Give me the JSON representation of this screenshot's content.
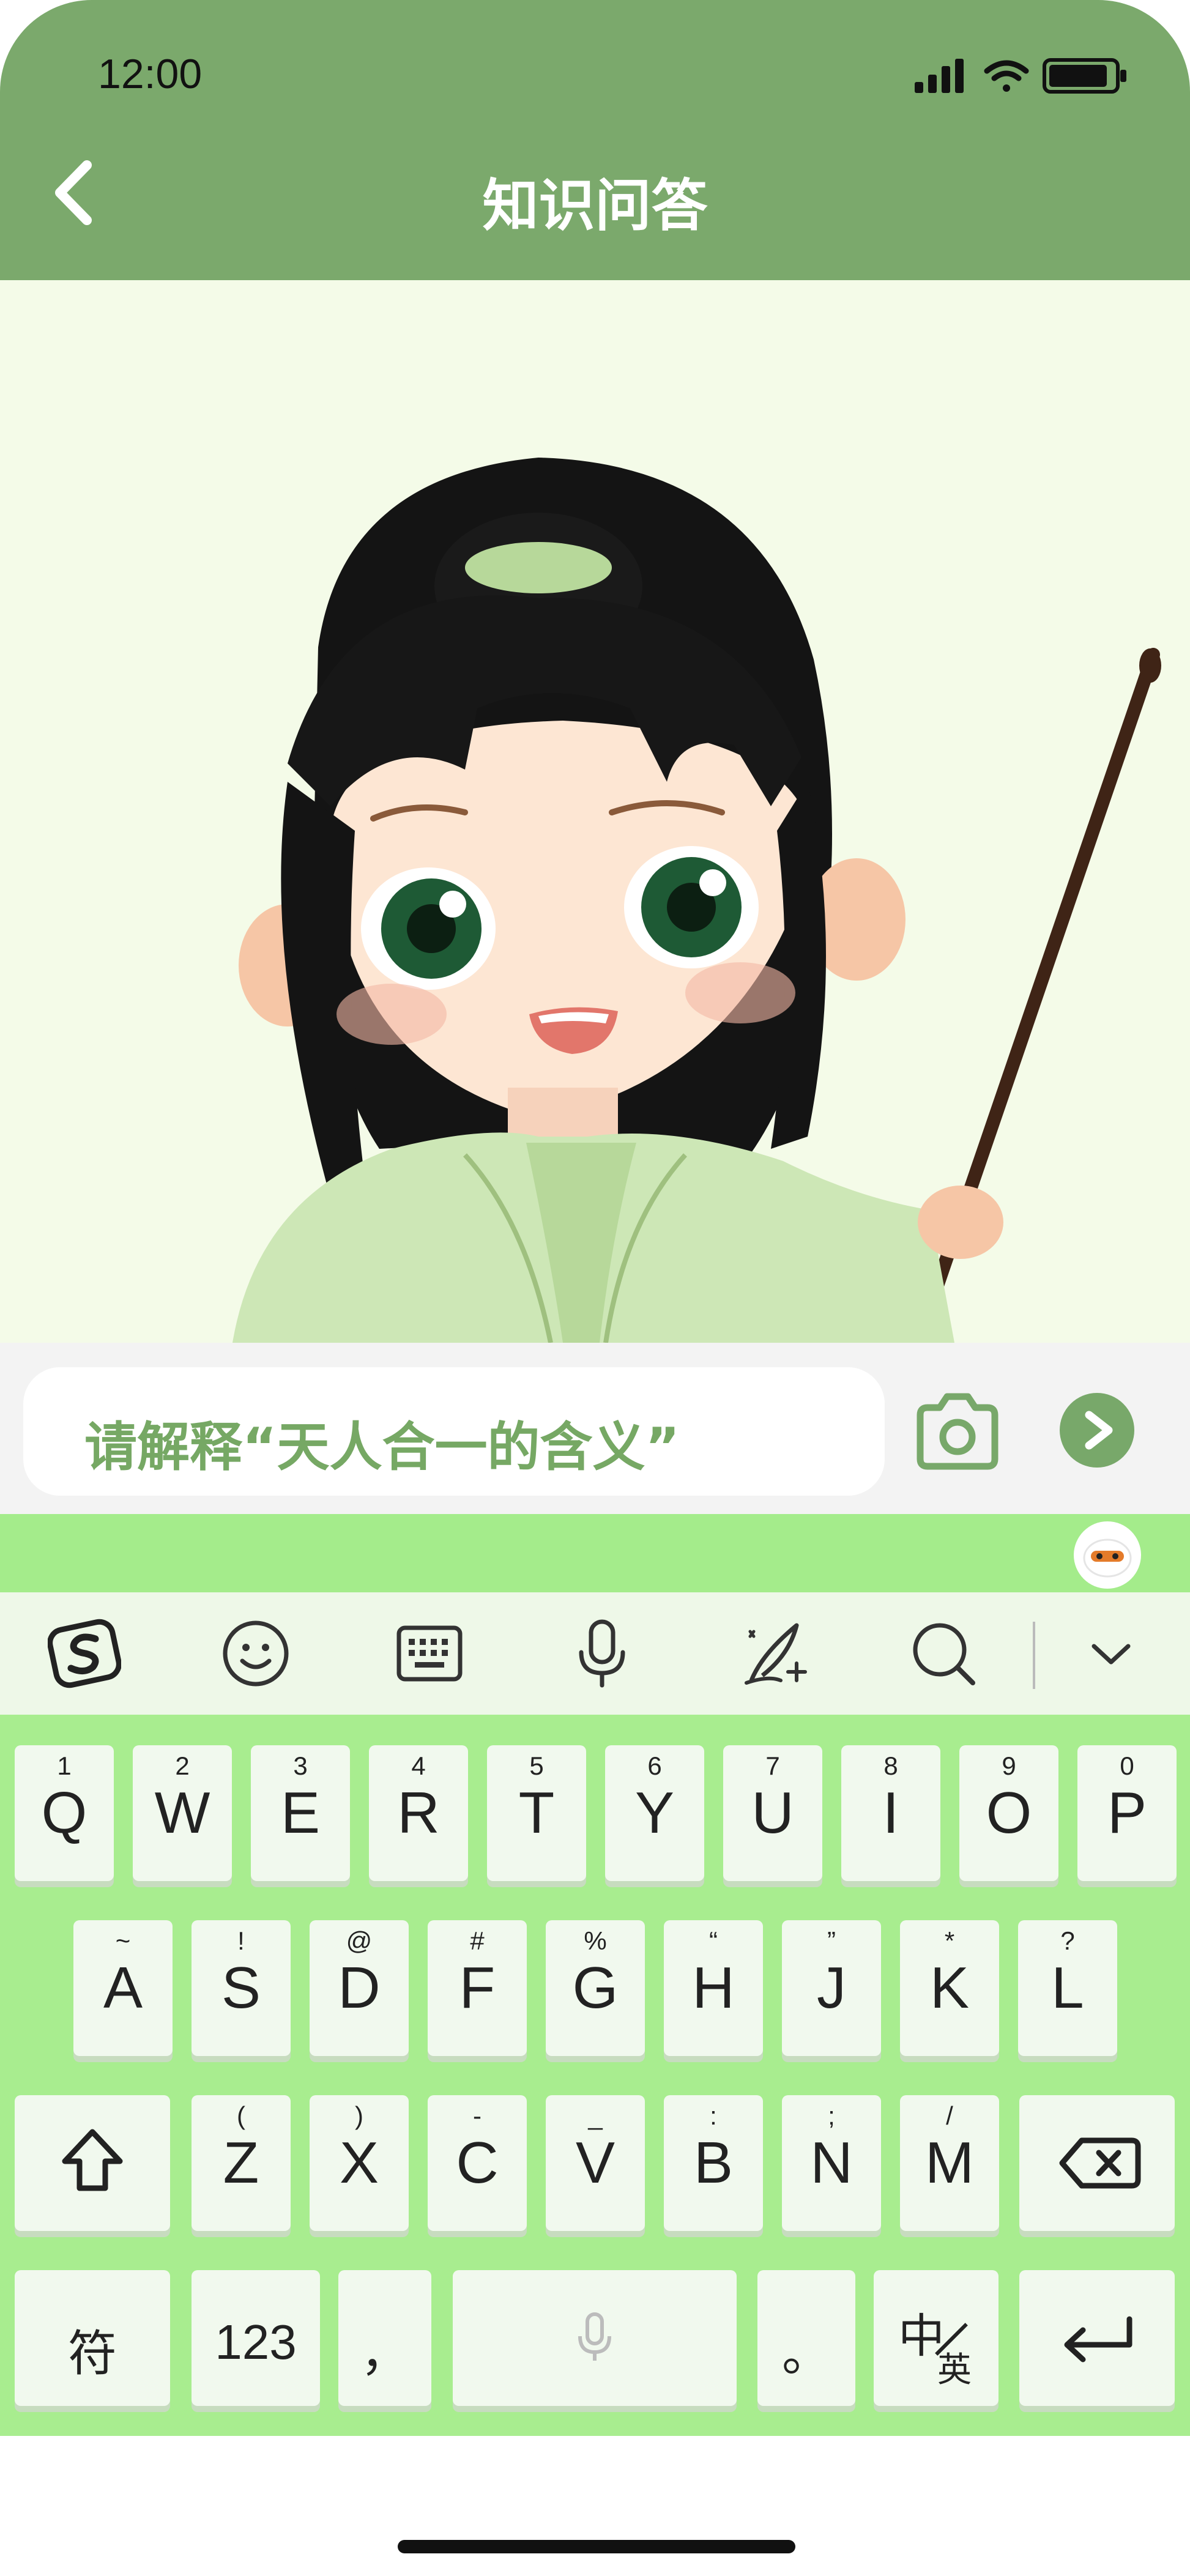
{
  "status_bar": {
    "time": "12:00"
  },
  "header": {
    "title": "知识问答"
  },
  "composer": {
    "input_text": "请解释“天人合一的含义”",
    "send_label": ">"
  },
  "keyboard": {
    "row1": [
      {
        "sup": "1",
        "main": "Q"
      },
      {
        "sup": "2",
        "main": "W"
      },
      {
        "sup": "3",
        "main": "E"
      },
      {
        "sup": "4",
        "main": "R"
      },
      {
        "sup": "5",
        "main": "T"
      },
      {
        "sup": "6",
        "main": "Y"
      },
      {
        "sup": "7",
        "main": "U"
      },
      {
        "sup": "8",
        "main": "I"
      },
      {
        "sup": "9",
        "main": "O"
      },
      {
        "sup": "0",
        "main": "P"
      }
    ],
    "row2": [
      {
        "sup": "~",
        "main": "A"
      },
      {
        "sup": "!",
        "main": "S"
      },
      {
        "sup": "@",
        "main": "D"
      },
      {
        "sup": "#",
        "main": "F"
      },
      {
        "sup": "%",
        "main": "G"
      },
      {
        "sup": "“",
        "main": "H"
      },
      {
        "sup": "”",
        "main": "J"
      },
      {
        "sup": "*",
        "main": "K"
      },
      {
        "sup": "?",
        "main": "L"
      }
    ],
    "row3": [
      {
        "sup": "(",
        "main": "Z"
      },
      {
        "sup": ")",
        "main": "X"
      },
      {
        "sup": "-",
        "main": "C"
      },
      {
        "sup": "_",
        "main": "V"
      },
      {
        "sup": ":",
        "main": "B"
      },
      {
        "sup": ";",
        "main": "N"
      },
      {
        "sup": "/",
        "main": "M"
      }
    ],
    "row4": {
      "symbols": "符",
      "numbers": "123",
      "comma": "，",
      "period": "。",
      "lang_main": "中",
      "lang_sub": "英"
    }
  },
  "colors": {
    "header": "#7ba96c",
    "keyboard": "#a8ed8f",
    "accent_text": "#76a864"
  }
}
